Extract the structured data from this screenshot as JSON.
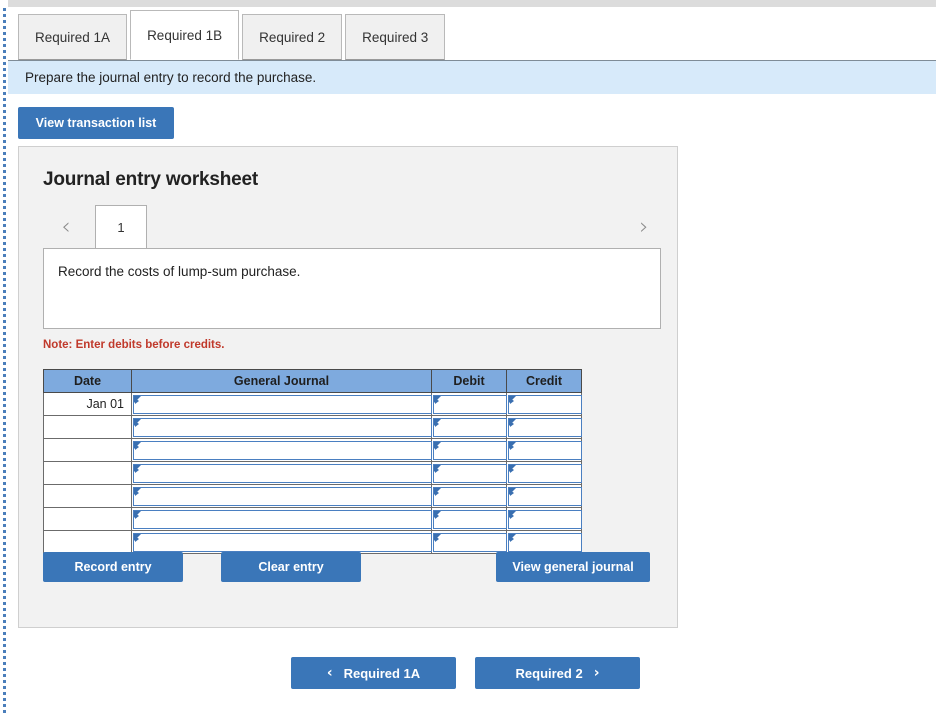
{
  "tabs": [
    {
      "label": "Required 1A",
      "active": false
    },
    {
      "label": "Required 1B",
      "active": true
    },
    {
      "label": "Required 2",
      "active": false
    },
    {
      "label": "Required 3",
      "active": false
    }
  ],
  "banner": {
    "text": "Prepare the journal entry to record the purchase."
  },
  "toolbar": {
    "view_transaction_list_label": "View transaction list"
  },
  "worksheet": {
    "title": "Journal entry worksheet",
    "pager": {
      "prev_icon": "‹",
      "next_icon": "›",
      "current_page": "1"
    },
    "description": "Record the costs of lump-sum purchase.",
    "note": "Note: Enter debits before credits.",
    "table": {
      "headers": [
        "Date",
        "General Journal",
        "Debit",
        "Credit"
      ],
      "rows": [
        {
          "date": "Jan 01",
          "general_journal": "",
          "debit": "",
          "credit": ""
        },
        {
          "date": "",
          "general_journal": "",
          "debit": "",
          "credit": ""
        },
        {
          "date": "",
          "general_journal": "",
          "debit": "",
          "credit": ""
        },
        {
          "date": "",
          "general_journal": "",
          "debit": "",
          "credit": ""
        },
        {
          "date": "",
          "general_journal": "",
          "debit": "",
          "credit": ""
        },
        {
          "date": "",
          "general_journal": "",
          "debit": "",
          "credit": ""
        },
        {
          "date": "",
          "general_journal": "",
          "debit": "",
          "credit": ""
        }
      ]
    },
    "actions": {
      "record_entry_label": "Record entry",
      "clear_entry_label": "Clear entry",
      "view_general_journal_label": "View general journal"
    }
  },
  "footer_nav": {
    "prev_arrow": "‹",
    "prev_label": "Required 1A",
    "next_label": "Required 2",
    "next_arrow": "›"
  },
  "colors": {
    "button_blue": "#3a76b8",
    "table_header_blue": "#7eaade",
    "banner_blue": "#d7eafa",
    "panel_gray": "#f2f2f2",
    "note_red": "#c0392b",
    "field_border_blue": "#4a7fc1"
  }
}
